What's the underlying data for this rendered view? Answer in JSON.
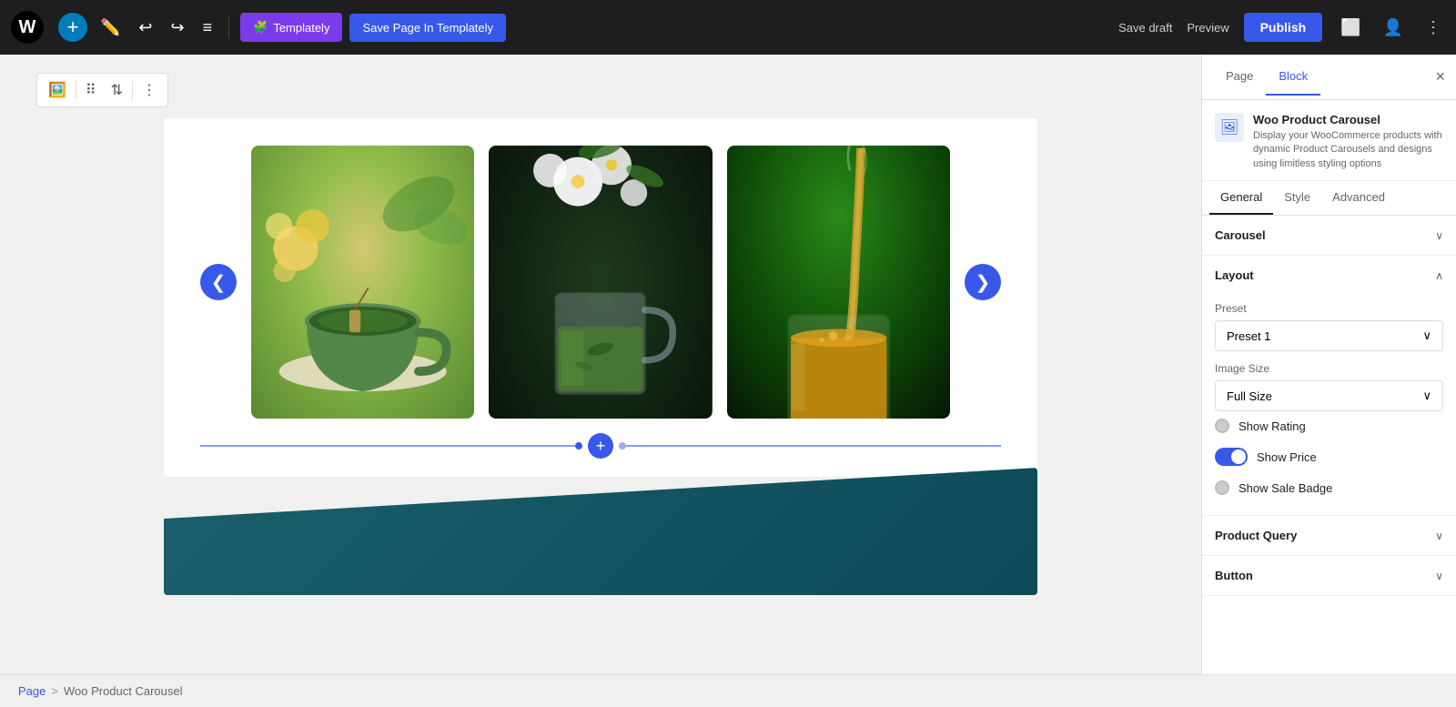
{
  "topbar": {
    "wp_logo": "W",
    "add_label": "+",
    "undo_label": "↩",
    "redo_label": "↪",
    "options_label": "≡",
    "templately_label": "Templately",
    "save_templately_label": "Save Page In Templately",
    "save_draft_label": "Save draft",
    "preview_label": "Preview",
    "publish_label": "Publish"
  },
  "block_toolbar": {
    "icon": "🖼",
    "move": "⠿",
    "arrows": "⇅",
    "more": "⋮"
  },
  "carousel": {
    "prev_label": "❮",
    "next_label": "❯",
    "images": [
      {
        "alt": "Green tea cup with yellow flowers",
        "bg": "img1"
      },
      {
        "alt": "Glass tea cup with white flowers",
        "bg": "img2"
      },
      {
        "alt": "Tea being poured in glass cup",
        "bg": "img3"
      }
    ],
    "add_block_label": "+"
  },
  "right_panel": {
    "tab_page": "Page",
    "tab_block": "Block",
    "close_label": "×",
    "block_title": "Woo Product Carousel",
    "block_desc": "Display your WooCommerce products with dynamic Product Carousels and designs using limitless styling options",
    "sub_tabs": [
      "General",
      "Style",
      "Advanced"
    ],
    "active_sub_tab": "General",
    "sections": [
      {
        "id": "carousel",
        "title": "Carousel",
        "collapsed": true,
        "chevron": "∨"
      },
      {
        "id": "layout",
        "title": "Layout",
        "collapsed": false,
        "chevron": "∧",
        "fields": {
          "preset_label": "Preset",
          "preset_value": "Preset 1",
          "image_size_label": "Image Size",
          "image_size_value": "Full Size",
          "toggles": [
            {
              "label": "Show Rating",
              "on": false
            },
            {
              "label": "Show Price",
              "on": true
            },
            {
              "label": "Show Sale Badge",
              "on": false
            }
          ]
        }
      },
      {
        "id": "product_query",
        "title": "Product Query",
        "collapsed": true,
        "chevron": "∨"
      },
      {
        "id": "button",
        "title": "Button",
        "collapsed": true,
        "chevron": "∨"
      }
    ]
  },
  "breadcrumb": {
    "page_label": "Page",
    "separator": ">",
    "current": "Woo Product Carousel"
  }
}
